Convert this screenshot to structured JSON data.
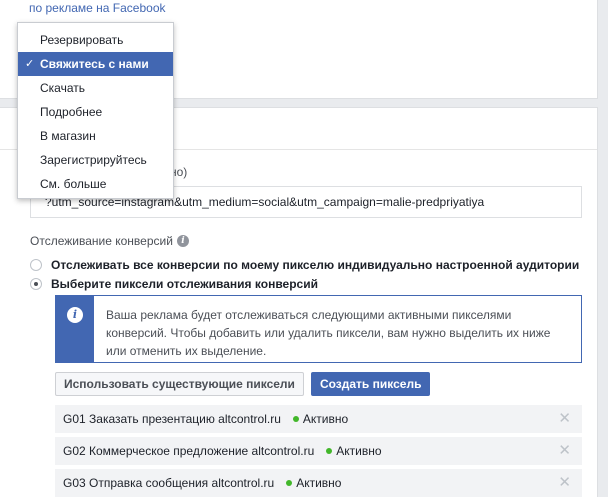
{
  "top": {
    "facebook_link": "по рекламе на Facebook"
  },
  "dropdown": {
    "items": [
      {
        "label": "Резервировать",
        "selected": false
      },
      {
        "label": "Свяжитесь с нами",
        "selected": true
      },
      {
        "label": "Скачать",
        "selected": false
      },
      {
        "label": "Подробнее",
        "selected": false
      },
      {
        "label": "В магазин",
        "selected": false
      },
      {
        "label": "Зарегистрируйтесь",
        "selected": false
      },
      {
        "label": "См. больше",
        "selected": false
      }
    ],
    "check_glyph": "✓"
  },
  "url": {
    "label_fragment": "но)",
    "value": "?utm_source=instagram&utm_medium=social&utm_campaign=malie-predpriyatiya"
  },
  "tracking": {
    "title": "Отслеживание конверсий",
    "info_glyph": "i",
    "options": [
      {
        "label": "Отслеживать все конверсии по моему пикселю индивидуально настроенной аудитории",
        "checked": false
      },
      {
        "label": "Выберите пиксели отслеживания конверсий",
        "checked": true
      }
    ],
    "notice": "Ваша реклама будет отслеживаться следующими активными пикселями конверсий. Чтобы добавить или удалить пиксели, вам нужно выделить их ниже или отменить их выделение.",
    "use_existing_button": "Использовать существующие пиксели",
    "create_button": "Создать пиксель",
    "pixels": [
      {
        "name": "G01 Заказать презентацию altcontrol.ru",
        "status": "Активно"
      },
      {
        "name": "G02 Коммерческое предложение altcontrol.ru",
        "status": "Активно"
      },
      {
        "name": "G03 Отправка сообщения altcontrol.ru",
        "status": "Активно"
      }
    ],
    "remove_glyph": "✕"
  },
  "colors": {
    "accent": "#4267b2",
    "active_dot": "#42b72a",
    "background": "#e9ebee"
  }
}
